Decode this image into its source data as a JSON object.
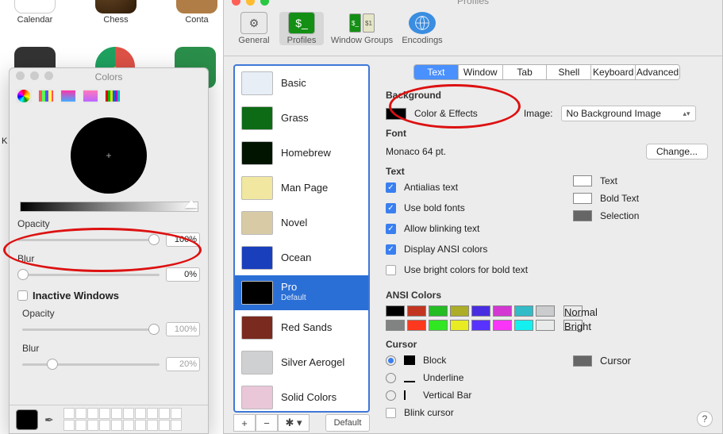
{
  "desktop": {
    "apps": [
      "Calendar",
      "Chess",
      "Conta"
    ]
  },
  "k_label": "K",
  "colors": {
    "title": "Colors",
    "opacity_label": "Opacity",
    "opacity_value": "100%",
    "blur_label": "Blur",
    "blur_value": "0%",
    "inactive_label": "Inactive Windows",
    "inactive_opacity_label": "Opacity",
    "inactive_opacity_value": "100%",
    "inactive_blur_label": "Blur",
    "inactive_blur_value": "20%"
  },
  "profiles": {
    "title": "Profiles",
    "toolbar": {
      "general": "General",
      "profiles": "Profiles",
      "windowGroups": "Window Groups",
      "encodings": "Encodings"
    },
    "items": [
      {
        "label": "Basic",
        "bg": "#e7eef6"
      },
      {
        "label": "Grass",
        "bg": "#0c6b14"
      },
      {
        "label": "Homebrew",
        "bg": "#001400"
      },
      {
        "label": "Man Page",
        "bg": "#f2e7a0"
      },
      {
        "label": "Novel",
        "bg": "#d8caa5"
      },
      {
        "label": "Ocean",
        "bg": "#1a3fbd"
      },
      {
        "label": "Pro",
        "bg": "#000",
        "default": "Default"
      },
      {
        "label": "Red Sands",
        "bg": "#7a2a1e"
      },
      {
        "label": "Silver Aerogel",
        "bg": "#cfd0d1"
      },
      {
        "label": "Solid Colors",
        "bg": "#e9c6d8"
      }
    ],
    "default_btn": "Default",
    "tabs": [
      "Text",
      "Window",
      "Tab",
      "Shell",
      "Keyboard",
      "Advanced"
    ],
    "background": {
      "heading": "Background",
      "color_effects": "Color & Effects",
      "image_label": "Image:",
      "image_value": "No Background Image"
    },
    "font": {
      "heading": "Font",
      "value": "Monaco 64 pt.",
      "change": "Change..."
    },
    "text": {
      "heading": "Text",
      "antialias": "Antialias text",
      "bold": "Use bold fonts",
      "blink": "Allow blinking text",
      "ansi": "Display ANSI colors",
      "bright": "Use bright colors for bold text",
      "text_lab": "Text",
      "bold_lab": "Bold Text",
      "sel_lab": "Selection"
    },
    "ansi": {
      "heading": "ANSI Colors",
      "normal": "Normal",
      "bright": "Bright",
      "row1": [
        "#000000",
        "#c23621",
        "#25bc24",
        "#adad27",
        "#492ee1",
        "#d338d3",
        "#33bbc8",
        "#cbcccd"
      ],
      "row2": [
        "#818383",
        "#fc391f",
        "#31e722",
        "#eaec23",
        "#5833ff",
        "#f935f8",
        "#14f0f0",
        "#e9ebeb"
      ]
    },
    "cursor": {
      "heading": "Cursor",
      "block": "Block",
      "underline": "Underline",
      "vbar": "Vertical Bar",
      "blink": "Blink cursor",
      "cursor_lab": "Cursor"
    }
  }
}
